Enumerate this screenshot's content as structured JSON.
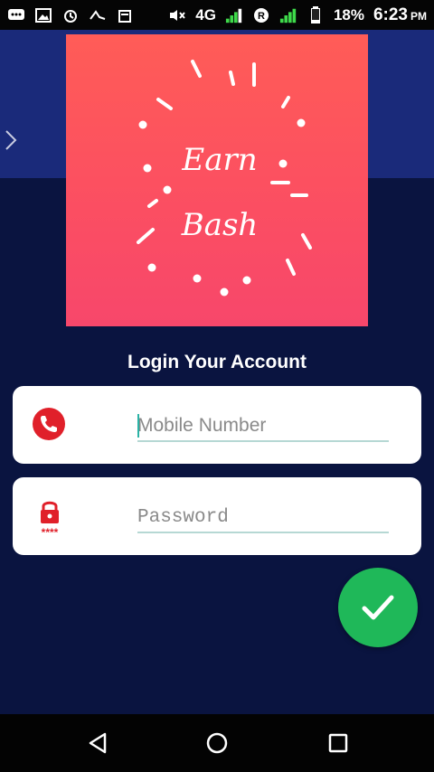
{
  "status_bar": {
    "network": "4G",
    "battery": "18%",
    "time": "6:23",
    "ampm": "PM"
  },
  "logo": {
    "line1": "Earn",
    "line2": "Bash",
    "gradient_top": "#ff5c57",
    "gradient_bottom": "#f7476b"
  },
  "login": {
    "title": "Login Your Account",
    "mobile_placeholder": "Mobile Number",
    "password_placeholder": "Password",
    "password_mask_icon": "****"
  },
  "colors": {
    "background": "#0a1440",
    "top_band": "#1a2a7a",
    "accent_green": "#1fb859",
    "icon_red": "#e0202a",
    "underline": "#b6d8d4"
  },
  "icons": {
    "phone": "phone-icon",
    "lock": "lock-icon",
    "submit": "checkmark-icon",
    "back": "back-triangle-icon",
    "home": "home-circle-icon",
    "recents": "recents-square-icon",
    "side": "chevron-right-icon"
  }
}
